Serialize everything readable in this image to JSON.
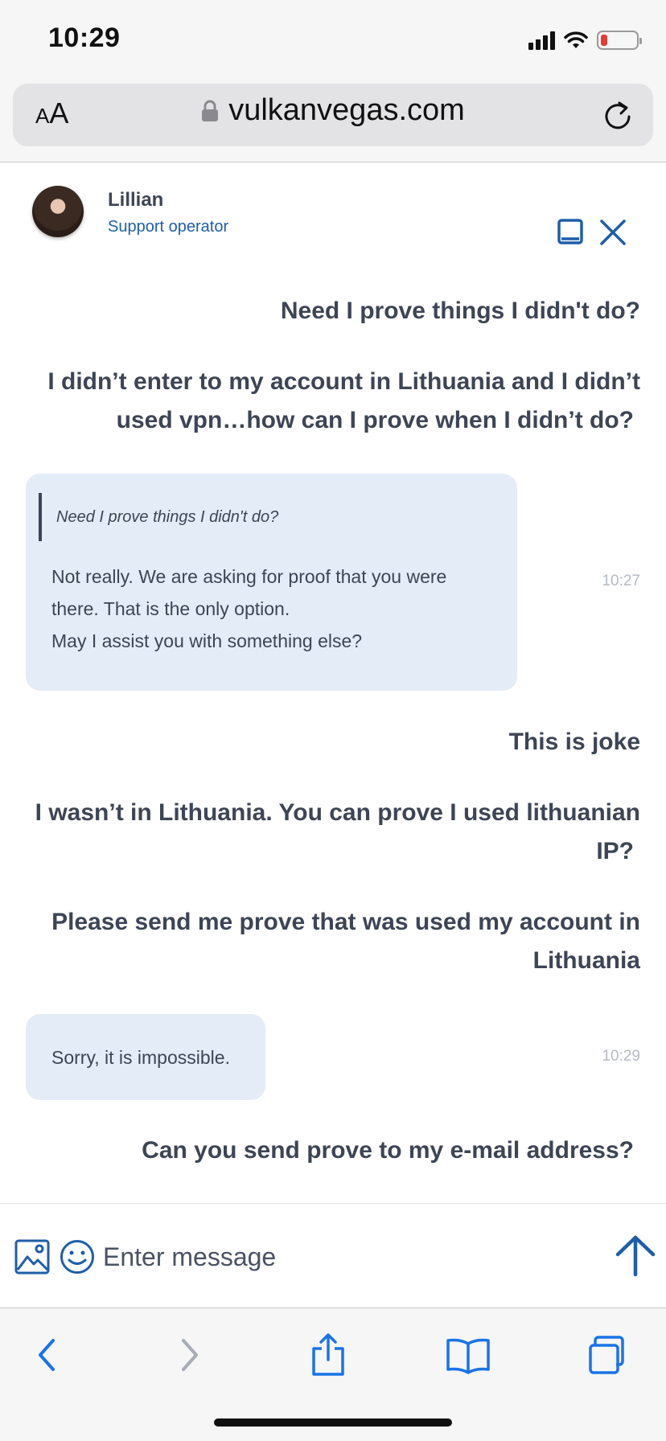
{
  "status_bar": {
    "time": "10:29"
  },
  "browser": {
    "text_size_button": {
      "small": "A",
      "large": "A"
    },
    "url": "vulkanvegas.com"
  },
  "chat": {
    "agent_name": "Lillian",
    "agent_role": "Support operator",
    "messages": [
      {
        "type": "user",
        "text": "Need I prove things I didn't do?"
      },
      {
        "type": "user",
        "lines": [
          "I didn’t enter to my account in Lithuania and I didn’t",
          "used vpn…how can I prove when I didn’t do?"
        ]
      },
      {
        "type": "operator",
        "quote": "Need I prove things I didn't do?",
        "lines": [
          "Not really. We are asking for proof that you were",
          "there. That is the only option.",
          "May I assist you with something else?"
        ],
        "time": "10:27"
      },
      {
        "type": "user",
        "text": "This is joke"
      },
      {
        "type": "user",
        "lines": [
          "I wasn’t in Lithuania. You can prove I used lithuanian",
          "IP?"
        ]
      },
      {
        "type": "user",
        "lines": [
          "Please send me prove that was used my account in",
          "Lithuania"
        ]
      },
      {
        "type": "operator",
        "text": "Sorry, it is impossible.",
        "time": "10:29"
      },
      {
        "type": "user",
        "text": "Can you send prove to my e-mail address?"
      }
    ]
  },
  "composer": {
    "placeholder": "Enter message"
  },
  "colors": {
    "accent": "#1e5ea8",
    "operator_bubble": "#e4ecf7",
    "text": "#3d4555",
    "timestamp": "#b6bac2"
  },
  "icons": {
    "text_size": "aa-icon",
    "lock": "lock-icon",
    "reload": "reload-icon",
    "minimize": "minimize-icon",
    "close": "close-icon",
    "image": "image-icon",
    "emoji": "emoji-icon",
    "send": "arrow-up-icon",
    "back": "chevron-left-icon",
    "forward": "chevron-right-icon",
    "share": "share-icon",
    "bookmarks": "book-icon",
    "tabs": "tabs-icon"
  }
}
